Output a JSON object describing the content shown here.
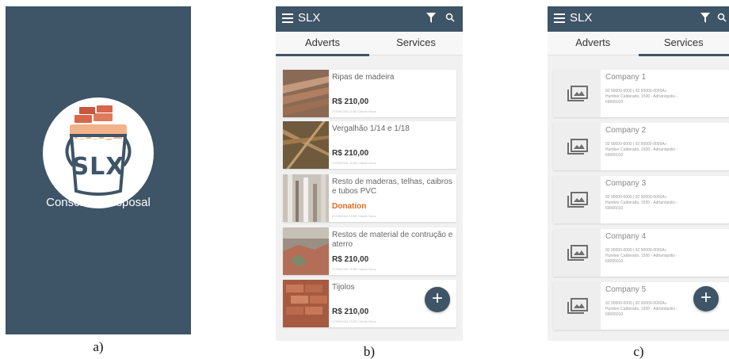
{
  "captions": [
    "a)",
    "b)",
    "c)"
  ],
  "splash": {
    "logo_text": "SLX",
    "title": "Conscious Disposal",
    "background": "#3e5467"
  },
  "app": {
    "title": "SLX",
    "menu_icon": "hamburger-menu-icon",
    "filter_icon": "filter-icon",
    "search_icon": "search-icon",
    "bar_color": "#3e5467"
  },
  "tabs": [
    "Adverts",
    "Services"
  ],
  "adverts": [
    {
      "title": "Ripas de madeira",
      "price": "R$ 210,00",
      "meta": "27/09/2018 13:55 Cidade Nova"
    },
    {
      "title": "Vergalhão 1/14 e 1/18",
      "price": "R$ 210,00",
      "meta": "27/09/2018 13:55 Cidade Nova"
    },
    {
      "title": "Resto de maderas, telhas, caibros e tubos PVC",
      "price": "Donation",
      "meta": "27/09/2018 13:55 Cidade Nova"
    },
    {
      "title": "Restos de material de contrução e aterro",
      "price": "R$ 210,00",
      "meta": "27/09/2018 13:55 Cidade Nova"
    },
    {
      "title": "Tijolos",
      "price": "R$ 210,00",
      "meta": "27/09/2018 13:55 Cidade Nova"
    }
  ],
  "services": [
    {
      "name": "Company 1",
      "phones": "92 90000-0000 | 92 90000-0000A»",
      "address": "Humber Calderado, 1500 - Adrianópolis -",
      "zip": "69065010"
    },
    {
      "name": "Company 2",
      "phones": "92 90000-0000 | 92 90000-0000A»",
      "address": "Humber Calderado, 1500 - Adrianópolis -",
      "zip": "69065010"
    },
    {
      "name": "Company 3",
      "phones": "92 90000-0000 | 92 90000-0000A»",
      "address": "Humber Calderado, 1500 - Adrianópolis -",
      "zip": "69065010"
    },
    {
      "name": "Company 4",
      "phones": "92 90000-0000 | 92 90000-0000A»",
      "address": "Humber Calderado, 1500 - Adrianópolis -",
      "zip": "69065010"
    },
    {
      "name": "Company 5",
      "phones": "92 90000-0000 | 92 90000-0000A»",
      "address": "Humber Calderado, 1500 - Adrianópolis -",
      "zip": "69065010"
    }
  ],
  "fab": {
    "label": "+",
    "icon": "add-icon"
  },
  "colors": {
    "accent": "#3e5467",
    "donation": "#e46a1c",
    "background": "#f1f1f1"
  }
}
